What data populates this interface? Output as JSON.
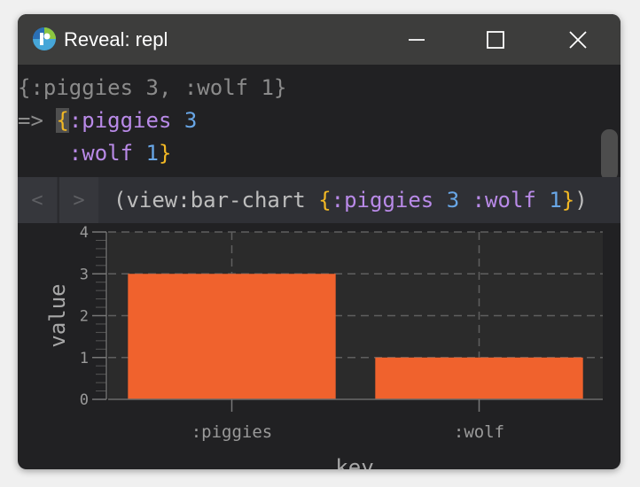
{
  "window": {
    "title": "Reveal: repl",
    "icon": "reveal-logo-icon",
    "controls": [
      "minimize-icon",
      "maximize-icon",
      "close-icon"
    ]
  },
  "repl": {
    "input": "{:piggies 3, :wolf 1}",
    "prompt": "=>",
    "result": {
      "open_brace": "{",
      "entries": [
        {
          "key": ":piggies",
          "value": "3"
        },
        {
          "key": ":wolf",
          "value": "1"
        }
      ],
      "close_brace": "}"
    }
  },
  "view": {
    "back_label": "<",
    "forward_label": ">",
    "expression": {
      "open_paren": "(",
      "fn": "view:bar-chart",
      "open_brace": "{",
      "key1": ":piggies",
      "val1": "3",
      "key2": ":wolf",
      "val2": "1",
      "close_brace": "}",
      "close_paren": ")"
    }
  },
  "colors": {
    "keyword": "#b98ae8",
    "number": "#68a6e6",
    "brace": "#f2b824",
    "bar": "#f0622d",
    "background": "#212123"
  },
  "chart_data": {
    "type": "bar",
    "categories": [
      ":piggies",
      ":wolf"
    ],
    "values": [
      3,
      1
    ],
    "xlabel": "key",
    "ylabel": "value",
    "ylim": [
      0,
      4
    ],
    "yticks": [
      0,
      1,
      2,
      3,
      4
    ],
    "grid": true
  }
}
